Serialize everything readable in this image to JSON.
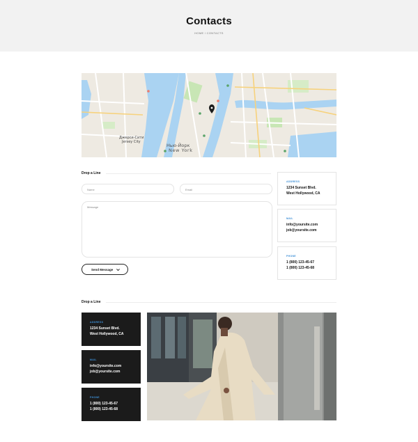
{
  "header": {
    "title": "Contacts",
    "breadcrumb": "HOME / CONTACTS"
  },
  "map": {
    "labels": {
      "jersey_ru": "Джерси-Сити",
      "jersey_en": "Jersey City",
      "ny_ru": "Нью-Йорк",
      "ny_en": "New York"
    }
  },
  "form_section": {
    "title": "Drop a Line",
    "name_placeholder": "Name",
    "email_placeholder": "Email",
    "message_placeholder": "Message",
    "submit_label": "Send Message"
  },
  "contact_cards": [
    {
      "caption": "ADDRESS",
      "line1": "1234 Sunset Blvd.",
      "line2": "West Hollywood, CA"
    },
    {
      "caption": "MAIL",
      "line1": "info@yoursite.com",
      "line2": "job@yoursite.com"
    },
    {
      "caption": "PHONE",
      "line1": "1 (800) 123-45-67",
      "line2": "1 (800) 123-45-68"
    }
  ],
  "info_section": {
    "title": "Drop a Line"
  },
  "dark_cards": [
    {
      "caption": "ADDRESS",
      "line1": "1234 Sunset Blvd.",
      "line2": "West Hollywood, CA"
    },
    {
      "caption": "MAIL",
      "line1": "info@yoursite.com",
      "line2": "job@yoursite.com"
    },
    {
      "caption": "PHONE",
      "line1": "1 (800) 123-45-67",
      "line2": "1 (800) 123-45-68"
    }
  ],
  "colors": {
    "accent": "#3d8fd6",
    "dark_card": "#1b1b1b",
    "hero_bg": "#f2f2f2",
    "water": "#aad3f2",
    "park": "#c8e6b5"
  },
  "icons": {
    "map_pin": "map-pin-icon",
    "send_chevron": "chevron-down-icon"
  }
}
